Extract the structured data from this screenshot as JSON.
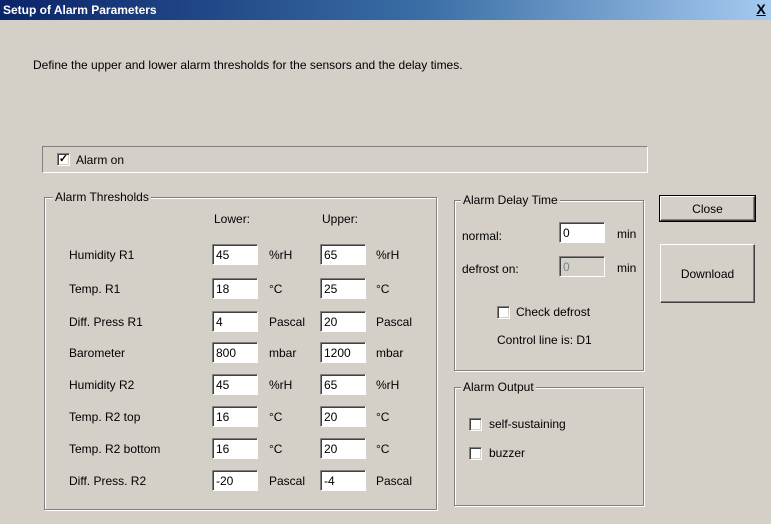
{
  "window": {
    "title": "Setup of Alarm Parameters",
    "close_glyph": "X",
    "description": "Define the upper and lower alarm thresholds for the sensors and the delay times."
  },
  "alarm_on": {
    "label": "Alarm on",
    "checked": true
  },
  "thresholds": {
    "legend": "Alarm Thresholds",
    "lower_header": "Lower:",
    "upper_header": "Upper:",
    "rows": [
      {
        "label": "Humidity R1",
        "lower": "45",
        "lower_unit": "%rH",
        "upper": "65",
        "upper_unit": "%rH"
      },
      {
        "label": "Temp. R1",
        "lower": "18",
        "lower_unit": "°C",
        "upper": "25",
        "upper_unit": "°C"
      },
      {
        "label": "Diff. Press R1",
        "lower": "4",
        "lower_unit": "Pascal",
        "upper": "20",
        "upper_unit": "Pascal"
      },
      {
        "label": "Barometer",
        "lower": "800",
        "lower_unit": "mbar",
        "upper": "1200",
        "upper_unit": "mbar"
      },
      {
        "label": "Humidity R2",
        "lower": "45",
        "lower_unit": "%rH",
        "upper": "65",
        "upper_unit": "%rH"
      },
      {
        "label": "Temp. R2 top",
        "lower": "16",
        "lower_unit": "°C",
        "upper": "20",
        "upper_unit": "°C"
      },
      {
        "label": "Temp. R2 bottom",
        "lower": "16",
        "lower_unit": "°C",
        "upper": "20",
        "upper_unit": "°C"
      },
      {
        "label": "Diff. Press. R2",
        "lower": "-20",
        "lower_unit": "Pascal",
        "upper": "-4",
        "upper_unit": "Pascal"
      }
    ]
  },
  "delay": {
    "legend": "Alarm Delay Time",
    "normal_label": "normal:",
    "normal_value": "0",
    "normal_unit": "min",
    "defrost_label": "defrost on:",
    "defrost_value": "0",
    "defrost_unit": "min",
    "check_defrost_label": "Check defrost",
    "check_defrost_checked": false,
    "control_line": "Control line is: D1"
  },
  "output": {
    "legend": "Alarm Output",
    "self_sustaining_label": "self-sustaining",
    "self_sustaining_checked": false,
    "buzzer_label": "buzzer",
    "buzzer_checked": false
  },
  "buttons": {
    "close": "Close",
    "download": "Download"
  },
  "colors": {
    "dialog_bg": "#d4d0c8",
    "title_start": "#0a246a",
    "title_end": "#a6caf0"
  }
}
